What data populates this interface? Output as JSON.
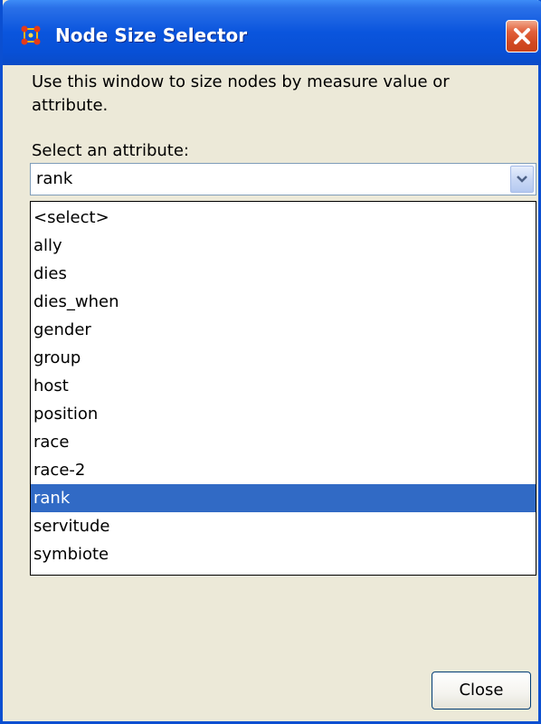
{
  "window": {
    "title": "Node Size Selector",
    "icon": "network-nodes-icon",
    "close_icon": "close-icon"
  },
  "description": "Use this window to size nodes by measure value or attribute.",
  "attribute": {
    "label": "Select an attribute:",
    "selected_value": "rank",
    "options": [
      "<select>",
      "ally",
      "dies",
      "dies_when",
      "gender",
      "group",
      "host",
      "position",
      "race",
      "race-2",
      "rank",
      "servitude",
      "symbiote"
    ],
    "highlighted_option": "rank"
  },
  "footer": {
    "close_label": "Close"
  },
  "colors": {
    "titlebar": "#0a55dd",
    "selection": "#316ac5",
    "close_button_red": "#d24a22",
    "window_background": "#ece9d8"
  }
}
